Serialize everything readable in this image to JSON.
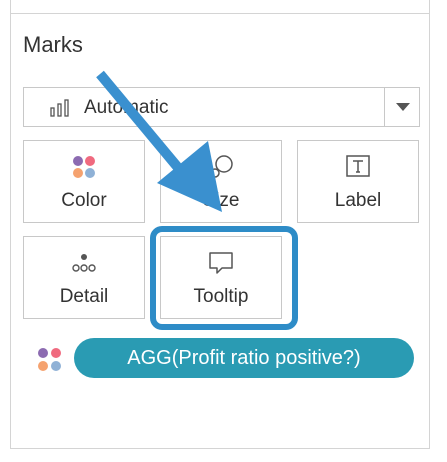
{
  "marks_card": {
    "title": "Marks",
    "mark_type": {
      "icon": "bar-chart-icon",
      "label": "Automatic",
      "dropdown_icon": "caret-down-icon"
    },
    "tiles": [
      {
        "id": "color",
        "label": "Color",
        "icon": "color-dots-icon"
      },
      {
        "id": "size",
        "label": "Size",
        "icon": "size-circles-icon"
      },
      {
        "id": "label",
        "label": "Label",
        "icon": "text-label-icon"
      },
      {
        "id": "detail",
        "label": "Detail",
        "icon": "detail-dots-icon"
      },
      {
        "id": "tooltip",
        "label": "Tooltip",
        "icon": "speech-bubble-icon"
      }
    ],
    "field_pill": {
      "icon": "color-dots-icon",
      "label": "AGG(Profit ratio positive?)",
      "color": "#2a9bb3"
    }
  },
  "annotation": {
    "arrow_color": "#3a90cf",
    "highlight_color": "#2e8cc7",
    "highlight_target": "tooltip"
  },
  "colors": {
    "dot_pink": "#f06a7f",
    "dot_purple": "#8c6bb1",
    "dot_orange": "#f5a26f",
    "dot_blue": "#8fb1d6"
  }
}
